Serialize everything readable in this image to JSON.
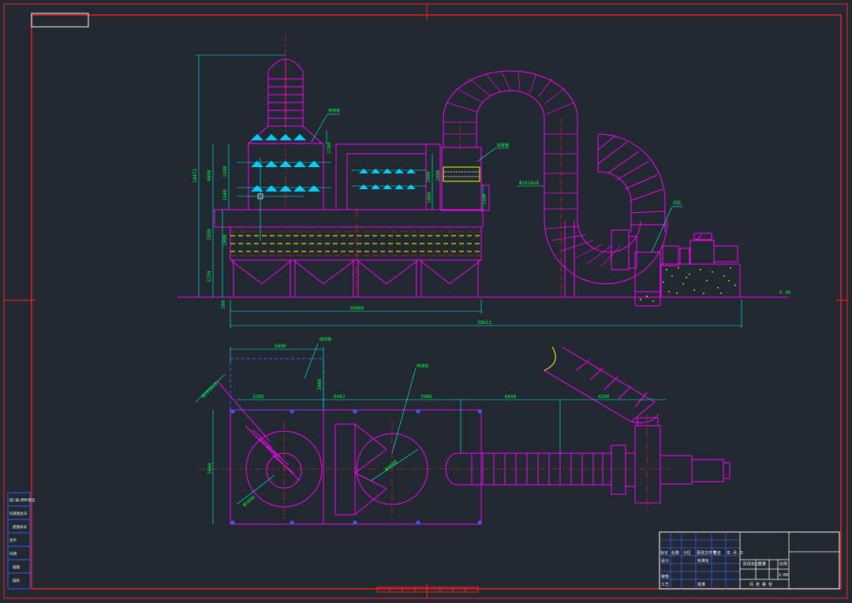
{
  "colors": {
    "background": "#212830",
    "frame": "#ff2020",
    "structure": "#ff00ff",
    "centerline": "#00ffff",
    "dimension": "#00ff3c",
    "spray": "#00ccff",
    "packing": "#ffff00",
    "hidden": "#3b5bff"
  },
  "elevation": {
    "dims": {
      "total_height": "14473",
      "h_upper": "4600",
      "h_mid": "2850",
      "h_lower": "2250",
      "h_base": "300",
      "h_inner1": "1780",
      "h_inner2": "1580",
      "h_inner3": "1580",
      "h_inner4": "1000",
      "h_inner5": "1000",
      "h_inner6": "1000",
      "h_inner7": "1000",
      "h_inner8": "1300",
      "len_tower": "16000",
      "len_total": "38611",
      "duct_diam": "Φ2016x8",
      "ground_level": "0.00"
    },
    "callouts": {
      "stack": "喷淋塔",
      "filter": "除雾器",
      "fan": "风机"
    }
  },
  "plan": {
    "dims": {
      "w_top": "6000",
      "d1": "3280",
      "d2": "6442",
      "d3": "3986",
      "d4": "6048",
      "d5": "4200",
      "w_left": "7000",
      "h_small": "3000",
      "diam_inlet": "Φ2016x8",
      "diam_tank1": "Φ5000",
      "diam_tank2": "Φ4600"
    },
    "callouts": {
      "tank": "储液箱",
      "tower": "喷淋塔"
    }
  },
  "title_block": {
    "row_labels": [
      "标记",
      "处数",
      "分区",
      "更改文件号",
      "签名",
      "年.月.日"
    ],
    "designer": "设计",
    "standard": "标准化",
    "review": "审核",
    "process": "工艺",
    "approve": "批准",
    "stage": "阶段标记",
    "weight": "重量",
    "scale_label": "比例",
    "scale": "1:60",
    "sheet": "共  张  第  张"
  },
  "side_table": [
    "借(通)用件登记",
    "旧底图总号",
    "底图总号",
    "签字",
    "日期",
    "描图",
    "描校"
  ],
  "top_tag": ""
}
